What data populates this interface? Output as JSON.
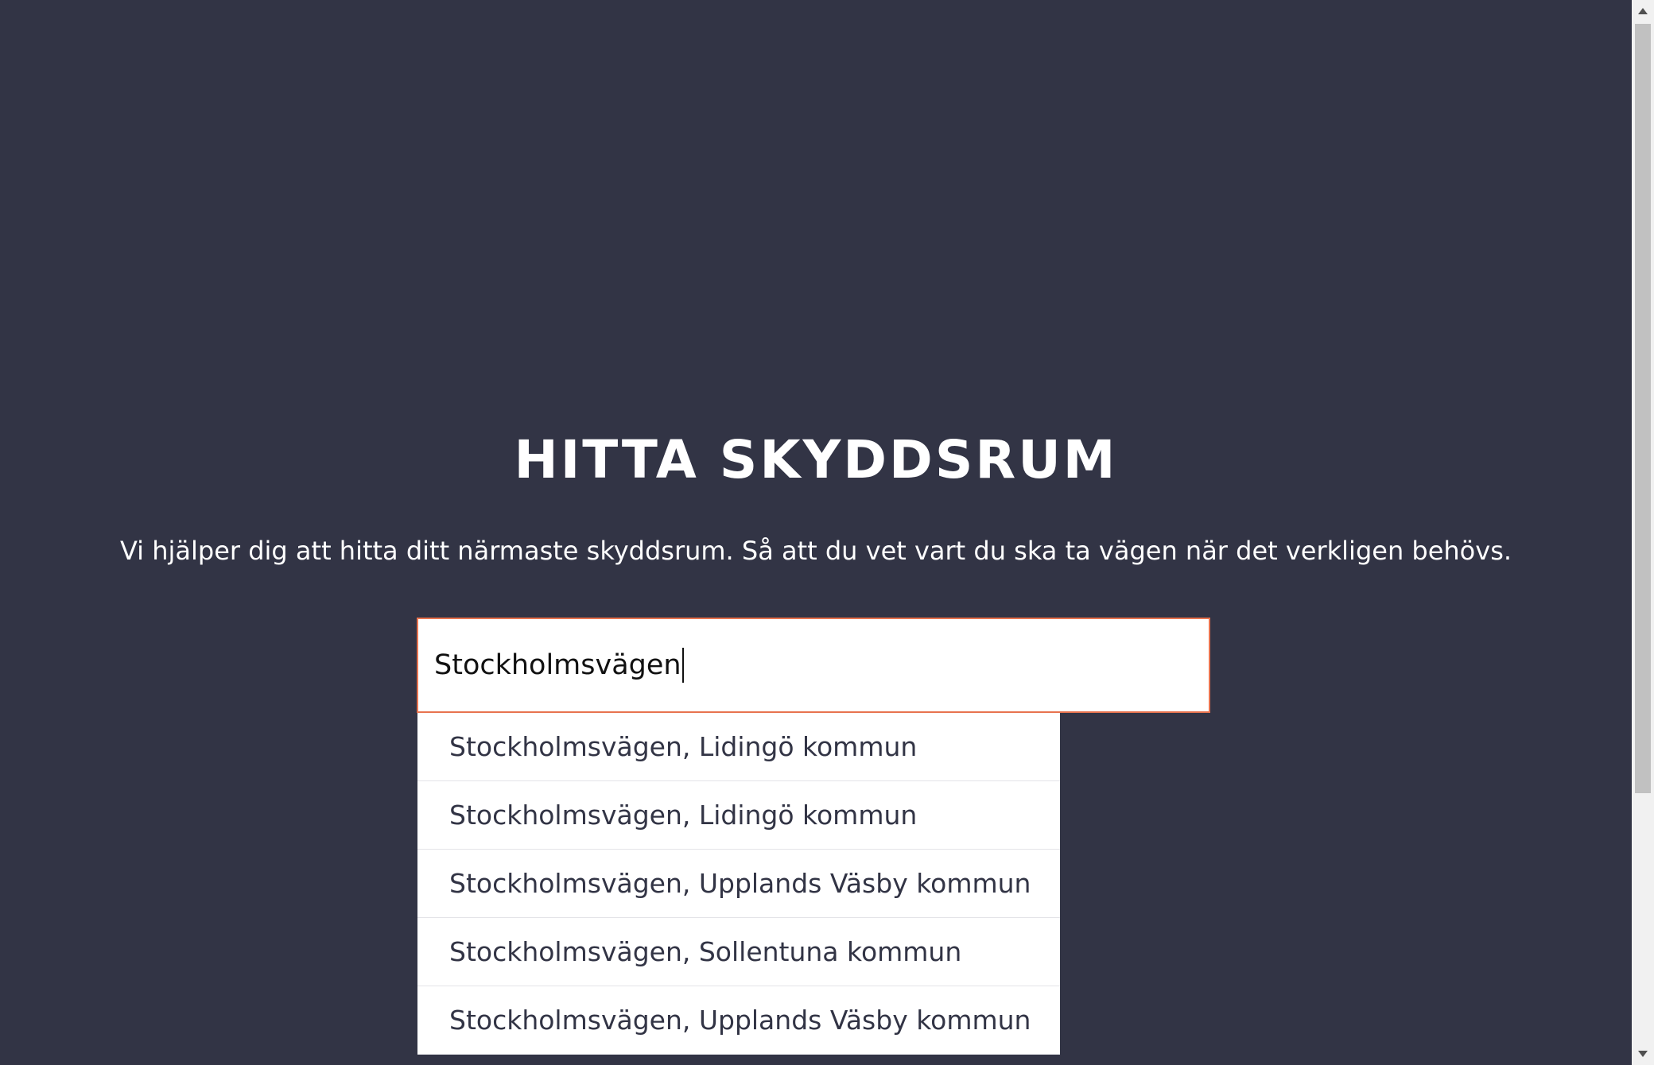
{
  "hero": {
    "title": "HITTA SKYDDSRUM",
    "subtitle": "Vi hjälper dig att hitta ditt närmaste skyddsrum. Så att du vet vart du ska ta vägen när det verkligen behövs."
  },
  "search": {
    "value": "Stockholmsvägen"
  },
  "suggestions": [
    "Stockholmsvägen, Lidingö kommun",
    "Stockholmsvägen, Lidingö kommun",
    "Stockholmsvägen, Upplands Väsby kommun",
    "Stockholmsvägen, Sollentuna kommun",
    "Stockholmsvägen, Upplands Väsby kommun"
  ],
  "colors": {
    "background": "#323445",
    "input_border": "#e8734f",
    "text_light": "#ffffff",
    "suggestion_text": "#323445"
  },
  "icons": {
    "scroll_up": "triangle-up-icon",
    "scroll_down": "triangle-down-icon"
  }
}
